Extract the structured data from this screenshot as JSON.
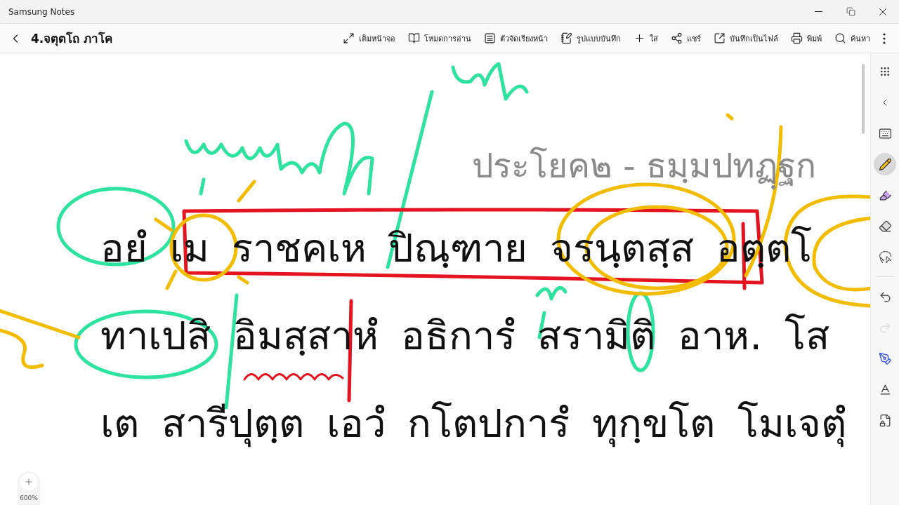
{
  "app_title": "Samsung Notes",
  "note_title": "4.จตุตโถ ภาโค",
  "toolbar": [
    {
      "kind": "fullscreen",
      "label": "เต็มหน้าจอ"
    },
    {
      "kind": "reading",
      "label": "โหมดการอ่าน"
    },
    {
      "kind": "pages",
      "label": "ตัวจัดเรียงหน้า"
    },
    {
      "kind": "style",
      "label": "รูปแบบบันทึก"
    },
    {
      "kind": "insert",
      "label": "ใส่"
    },
    {
      "kind": "share",
      "label": "แชร์"
    },
    {
      "kind": "export",
      "label": "บันทึกเป็นไฟล์"
    },
    {
      "kind": "print",
      "label": "พิมพ์"
    },
    {
      "kind": "search",
      "label": "ค้นหา"
    }
  ],
  "heading": "ประโยค๒ - ธมฺมปทฏฺฐก",
  "lines": [
    "อยํ เม ราชคเห ปิณฺฑาย จรนฺตสฺส อตฺตโ",
    "ทาเปสิ อิมสฺสาหํ อธิการํ สรามิติ อาห. โส",
    "เต สารีปุตฺต เอวํ กโตปการํ ทุกฺขโต โมเจตุํ"
  ],
  "tools": [
    {
      "kind": "pen",
      "selected": true
    },
    {
      "kind": "highlighter",
      "selected": false
    },
    {
      "kind": "eraser",
      "selected": false
    },
    {
      "kind": "lasso",
      "selected": false
    }
  ],
  "history": [
    {
      "kind": "undo",
      "disabled": false
    },
    {
      "kind": "redo",
      "disabled": true
    }
  ],
  "zoom": "600%"
}
